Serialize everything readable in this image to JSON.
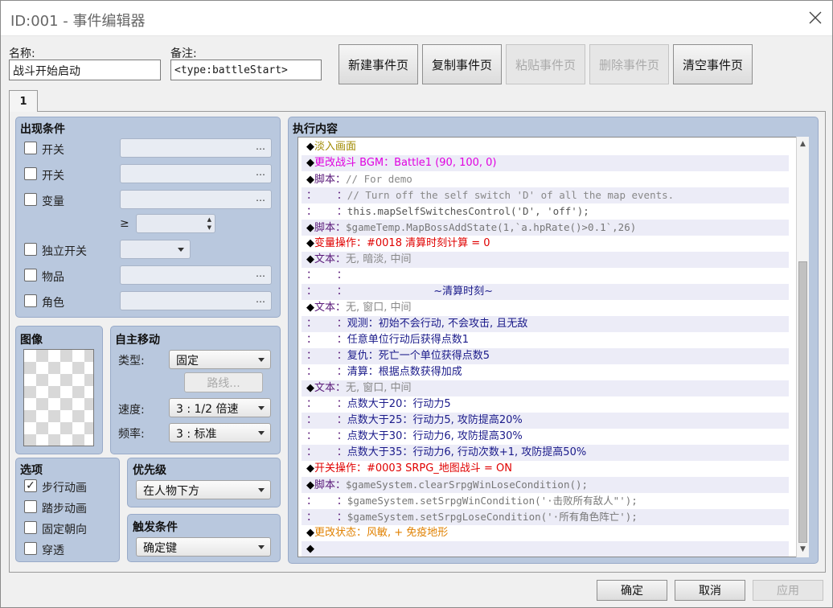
{
  "window": {
    "title": "ID:001 - 事件编辑器"
  },
  "header": {
    "name_label": "名称:",
    "name_value": "战斗开始启动",
    "note_label": "备注:",
    "note_value": "<type:battleStart>",
    "buttons": [
      {
        "label": "新建事件页",
        "enabled": true
      },
      {
        "label": "复制事件页",
        "enabled": true
      },
      {
        "label": "粘贴事件页",
        "enabled": false
      },
      {
        "label": "删除事件页",
        "enabled": false
      },
      {
        "label": "清空事件页",
        "enabled": true
      }
    ]
  },
  "tabs": [
    {
      "label": "1",
      "active": true
    }
  ],
  "conditions": {
    "title": "出现条件",
    "switch1_label": "开关",
    "switch2_label": "开关",
    "variable_label": "变量",
    "geq_symbol": "≥",
    "self_switch_label": "独立开关",
    "item_label": "物品",
    "actor_label": "角色",
    "more": "…"
  },
  "image": {
    "title": "图像"
  },
  "autonomous_movement": {
    "title": "自主移动",
    "type_label": "类型:",
    "type_value": "固定",
    "route_button": "路线...",
    "speed_label": "速度:",
    "speed_value": "3 : 1/2 倍速",
    "freq_label": "频率:",
    "freq_value": "3 : 标准"
  },
  "options": {
    "title": "选项",
    "items": [
      {
        "label": "步行动画",
        "checked": true
      },
      {
        "label": "踏步动画",
        "checked": false
      },
      {
        "label": "固定朝向",
        "checked": false
      },
      {
        "label": "穿透",
        "checked": false
      }
    ]
  },
  "priority": {
    "title": "优先级",
    "value": "在人物下方"
  },
  "trigger": {
    "title": "触发条件",
    "value": "确定键"
  },
  "contents": {
    "title": "执行内容",
    "lines": [
      {
        "segments": [
          {
            "t": "◆",
            "c": "#000"
          },
          {
            "t": "淡入画面",
            "c": "#a08a00"
          }
        ]
      },
      {
        "segments": [
          {
            "t": "◆",
            "c": "#000"
          },
          {
            "t": "更改战斗 BGM：Battle1 (90, 100, 0)",
            "c": "#e000e0"
          }
        ]
      },
      {
        "segments": [
          {
            "t": "◆",
            "c": "#000"
          },
          {
            "t": "脚本：",
            "c": "#5a1a7a"
          },
          {
            "t": "// For demo",
            "c": "#888",
            "mono": true
          }
        ]
      },
      {
        "segments": [
          {
            "t": "：      ：",
            "c": "#5a1a7a"
          },
          {
            "t": "// Turn off the self switch 'D' of all the map events.",
            "c": "#888",
            "mono": true
          }
        ]
      },
      {
        "segments": [
          {
            "t": "：      ：",
            "c": "#5a1a7a"
          },
          {
            "t": "this.mapSelfSwitchesControl('D', 'off');",
            "c": "#555",
            "mono": true
          }
        ]
      },
      {
        "segments": [
          {
            "t": "◆",
            "c": "#000"
          },
          {
            "t": "脚本：",
            "c": "#5a1a7a"
          },
          {
            "t": "$gameTemp.MapBossAddState(1,`a.hpRate()>0.1`,26)",
            "c": "#777",
            "mono": true
          }
        ]
      },
      {
        "segments": [
          {
            "t": "◆",
            "c": "#000"
          },
          {
            "t": "变量操作：#0018 清算时刻计算 = 0",
            "c": "#e00000"
          }
        ]
      },
      {
        "segments": [
          {
            "t": "◆",
            "c": "#000"
          },
          {
            "t": "文本：",
            "c": "#5a1a7a"
          },
          {
            "t": "无, 暗淡, 中间",
            "c": "#888"
          }
        ]
      },
      {
        "segments": [
          {
            "t": "：      ：",
            "c": "#5a1a7a"
          }
        ]
      },
      {
        "segments": [
          {
            "t": "：      ：",
            "c": "#5a1a7a"
          },
          {
            "t": "                          ~清算时刻~",
            "c": "#1a1a8a"
          }
        ]
      },
      {
        "segments": [
          {
            "t": "◆",
            "c": "#000"
          },
          {
            "t": "文本：",
            "c": "#5a1a7a"
          },
          {
            "t": "无, 窗口, 中间",
            "c": "#888"
          }
        ]
      },
      {
        "segments": [
          {
            "t": "：      ：",
            "c": "#5a1a7a"
          },
          {
            "t": "观测：初始不会行动, 不会攻击, 且无敌",
            "c": "#1a1a8a"
          }
        ]
      },
      {
        "segments": [
          {
            "t": "：      ：",
            "c": "#5a1a7a"
          },
          {
            "t": "任意单位行动后获得点数1",
            "c": "#1a1a8a"
          }
        ]
      },
      {
        "segments": [
          {
            "t": "：      ：",
            "c": "#5a1a7a"
          },
          {
            "t": "复仇：死亡一个单位获得点数5",
            "c": "#1a1a8a"
          }
        ]
      },
      {
        "segments": [
          {
            "t": "：      ：",
            "c": "#5a1a7a"
          },
          {
            "t": "清算：根据点数获得加成",
            "c": "#1a1a8a"
          }
        ]
      },
      {
        "segments": [
          {
            "t": "◆",
            "c": "#000"
          },
          {
            "t": "文本：",
            "c": "#5a1a7a"
          },
          {
            "t": "无, 窗口, 中间",
            "c": "#888"
          }
        ]
      },
      {
        "segments": [
          {
            "t": "：      ：",
            "c": "#5a1a7a"
          },
          {
            "t": "点数大于20：行动力5",
            "c": "#1a1a8a"
          }
        ]
      },
      {
        "segments": [
          {
            "t": "：      ：",
            "c": "#5a1a7a"
          },
          {
            "t": "点数大于25：行动力5, 攻防提高20%",
            "c": "#1a1a8a"
          }
        ]
      },
      {
        "segments": [
          {
            "t": "：      ：",
            "c": "#5a1a7a"
          },
          {
            "t": "点数大于30：行动力6, 攻防提高30%",
            "c": "#1a1a8a"
          }
        ]
      },
      {
        "segments": [
          {
            "t": "：      ：",
            "c": "#5a1a7a"
          },
          {
            "t": "点数大于35：行动力6, 行动次数+1, 攻防提高50%",
            "c": "#1a1a8a"
          }
        ]
      },
      {
        "segments": [
          {
            "t": "◆",
            "c": "#000"
          },
          {
            "t": "开关操作：#0003 SRPG_地图战斗 = ON",
            "c": "#e00000"
          }
        ]
      },
      {
        "segments": [
          {
            "t": "◆",
            "c": "#000"
          },
          {
            "t": "脚本：",
            "c": "#5a1a7a"
          },
          {
            "t": "$gameSystem.clearSrpgWinLoseCondition();",
            "c": "#777",
            "mono": true
          }
        ]
      },
      {
        "segments": [
          {
            "t": "：      ：",
            "c": "#5a1a7a"
          },
          {
            "t": "$gameSystem.setSrpgWinCondition('·击败所有敌人\"');",
            "c": "#777",
            "mono": true
          }
        ]
      },
      {
        "segments": [
          {
            "t": "：      ：",
            "c": "#5a1a7a"
          },
          {
            "t": "$gameSystem.setSrpgLoseCondition('·所有角色阵亡');",
            "c": "#777",
            "mono": true
          }
        ]
      },
      {
        "segments": [
          {
            "t": "◆",
            "c": "#000"
          },
          {
            "t": "更改状态：风敏, + 免疫地形",
            "c": "#e08000"
          }
        ]
      },
      {
        "segments": [
          {
            "t": "◆",
            "c": "#000"
          }
        ]
      }
    ]
  },
  "footer": {
    "ok": "确定",
    "cancel": "取消",
    "apply": "应用"
  },
  "colors": {
    "group_bg": "#b9c8de",
    "accent_panel": "#b9c8de"
  }
}
